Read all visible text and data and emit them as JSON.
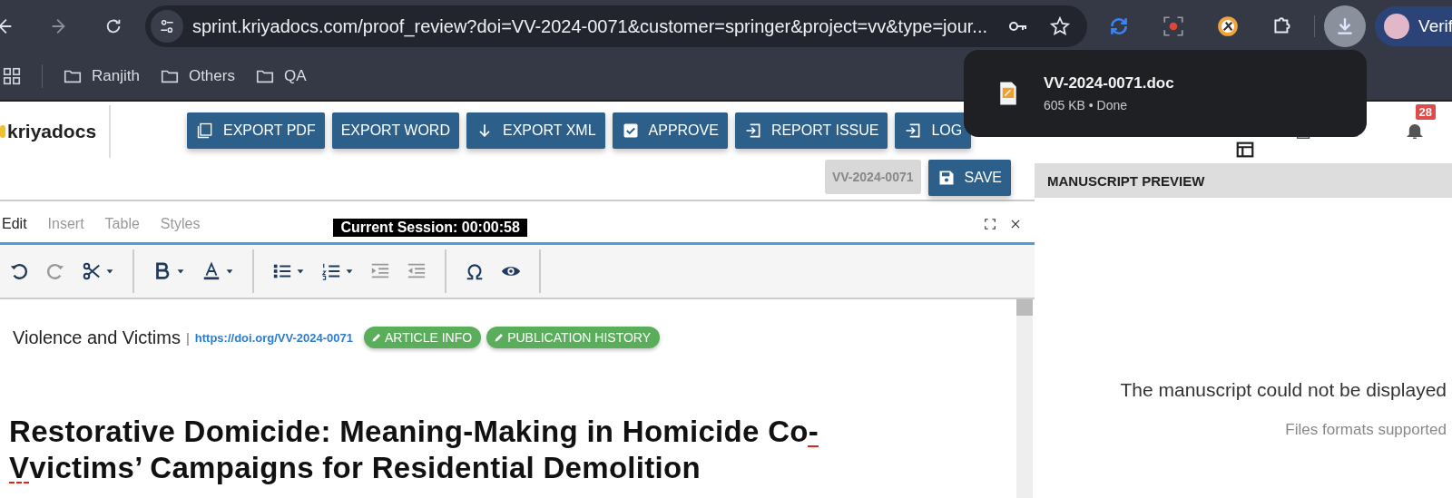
{
  "browser": {
    "url": "sprint.kriyadocs.com/proof_review?doi=VV-2024-0071&customer=springer&project=vv&type=jour...",
    "profile": "Verif",
    "bookmarks": [
      {
        "label": "Ranjith"
      },
      {
        "label": "Others"
      },
      {
        "label": "QA"
      }
    ],
    "download": {
      "file": "VV-2024-0071.doc",
      "status": "605 KB • Done"
    }
  },
  "header": {
    "buttons": [
      {
        "kind": "pdf",
        "label": "EXPORT PDF"
      },
      {
        "kind": "none",
        "label": "EXPORT WORD"
      },
      {
        "kind": "down",
        "label": "EXPORT XML"
      },
      {
        "kind": "check",
        "label": "APPROVE"
      },
      {
        "kind": "enter",
        "label": "REPORT ISSUE"
      },
      {
        "kind": "enter",
        "label": "LOG"
      }
    ],
    "logo": "kriyadocs",
    "doi_badge": "VV-2024-0071",
    "save": "SAVE",
    "notifications": "28"
  },
  "editor": {
    "menu": [
      {
        "label": "Edit",
        "selected": true
      },
      {
        "label": "Insert",
        "selected": false
      },
      {
        "label": "Table",
        "selected": false
      },
      {
        "label": "Styles",
        "selected": false
      }
    ],
    "session": "Current Session: 00:00:58",
    "journal": "Violence and Victims",
    "separator": "|",
    "doi_link": "https://doi.org/VV-2024-0071",
    "tags": [
      {
        "label": "ARTICLE INFO"
      },
      {
        "label": "PUBLICATION HISTORY"
      }
    ],
    "title_lines": [
      [
        {
          "text": "Restorative Domicide: Meaning-Making in Homicide Co",
          "deleted": false
        },
        {
          "text": "-",
          "deleted": true
        }
      ],
      [
        {
          "text": "V",
          "deleted": true
        },
        {
          "text": "victims’ Campaigns for Residential Demolition",
          "deleted": false
        }
      ]
    ]
  },
  "preview": {
    "heading": "MANUSCRIPT PREVIEW",
    "message": "The manuscript could not be displayed",
    "note": "Files formats supported"
  }
}
